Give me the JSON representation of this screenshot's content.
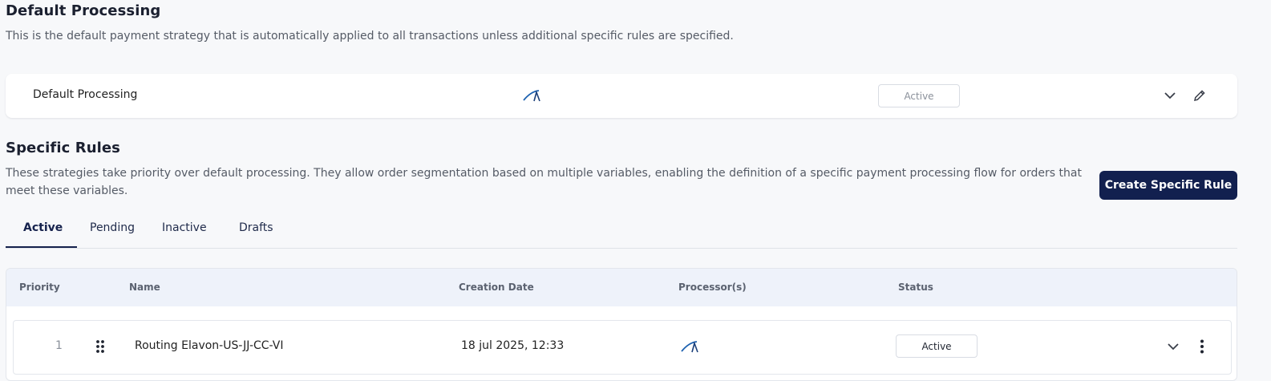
{
  "default_section": {
    "title": "Default Processing",
    "description": "This is the default payment strategy that is automatically applied to all transactions unless additional specific rules are specified.",
    "card": {
      "name": "Default Processing",
      "status": "Active"
    }
  },
  "specific_section": {
    "title": "Specific Rules",
    "description_line1": "These strategies take priority over default processing. They allow order segmentation based on multiple variables, enabling the definition of a specific payment processing flow for orders that",
    "description_line2": "meet these variables.",
    "create_button": "Create Specific Rule"
  },
  "tabs": [
    {
      "label": "Active",
      "active": true
    },
    {
      "label": "Pending",
      "active": false
    },
    {
      "label": "Inactive",
      "active": false
    },
    {
      "label": "Drafts",
      "active": false
    }
  ],
  "table": {
    "headers": {
      "priority": "Priority",
      "name": "Name",
      "creation_date": "Creation Date",
      "processors": "Processor(s)",
      "status": "Status"
    },
    "rows": [
      {
        "priority": "1",
        "name": "Routing Elavon-US-JJ-CC-VI",
        "creation_date": "18 jul 2025, 12:33",
        "processor_icon": "elavon-logo-icon",
        "status": "Active"
      }
    ]
  },
  "icons": {
    "processor_logo": "elavon-logo-icon",
    "expand": "chevron-down-icon",
    "edit": "pencil-icon",
    "drag": "drag-handle-icon",
    "more": "more-vertical-icon"
  },
  "colors": {
    "primary": "#12204f",
    "background": "#f7f8fa",
    "table_header": "#eef2fa",
    "logo_blue": "#1e62b0"
  }
}
